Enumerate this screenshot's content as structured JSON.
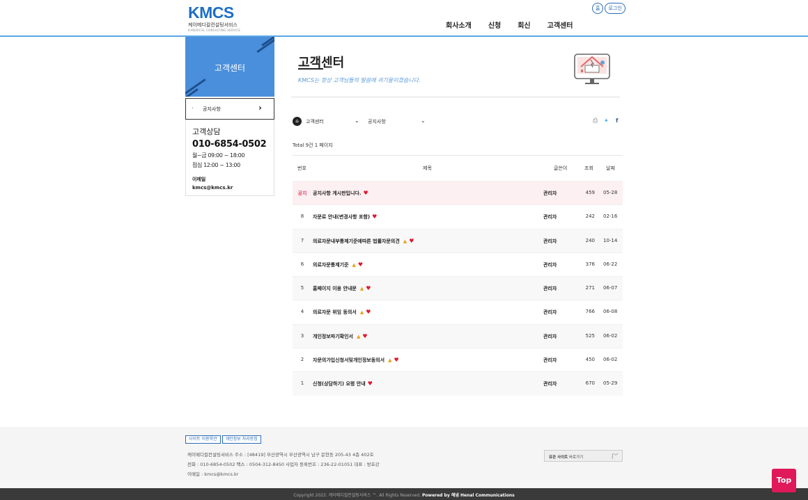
{
  "header": {
    "logo_main": "KMCS",
    "logo_sub": "케이메디컬컨설팅서비스",
    "logo_tiny": "K-MEDICAL CONSULTING SERVICE",
    "home_btn": "홈",
    "login_btn": "로그인",
    "nav": [
      "회사소개",
      "신청",
      "회신",
      "고객센터"
    ]
  },
  "sidebar": {
    "banner_title": "고객센터",
    "menu_item": "공지사항",
    "consult_title": "고객상담",
    "phone": "010-6854-0502",
    "hours_1": "월~금 09:00 ~ 18:00",
    "hours_2": "점심 12:00 ~ 13:00",
    "email_label": "이메일",
    "email": "kmcs@kmcs.kr"
  },
  "main": {
    "title": "고객센터",
    "subtitle": "KMCS는 항상 고객님들의 말씀에 귀기울이겠습니다.",
    "path_select_1": "고객센터",
    "path_select_2": "공지사항",
    "total": "Total 9건 1 페이지",
    "columns": {
      "num": "번호",
      "title": "제목",
      "author": "글쓴이",
      "views": "조회",
      "date": "날짜"
    }
  },
  "rows": [
    {
      "num": "공지",
      "title": "공지사항 게시판입니다.",
      "author": "관리자",
      "views": "459",
      "date": "05-28",
      "warn": false
    },
    {
      "num": "8",
      "title": "자문료 안내(변경사항 포함)",
      "author": "관리자",
      "views": "242",
      "date": "02-16",
      "warn": false
    },
    {
      "num": "7",
      "title": "의료자문내부통제기준에따른 법률자문의견",
      "author": "관리자",
      "views": "240",
      "date": "10-14",
      "warn": true
    },
    {
      "num": "6",
      "title": "의료자문통제기준",
      "author": "관리자",
      "views": "376",
      "date": "06-22",
      "warn": true
    },
    {
      "num": "5",
      "title": "홈페이지 이용 안내문",
      "author": "관리자",
      "views": "271",
      "date": "06-07",
      "warn": true
    },
    {
      "num": "4",
      "title": "의료자문 위임 동의서",
      "author": "관리자",
      "views": "766",
      "date": "06-08",
      "warn": true
    },
    {
      "num": "3",
      "title": "개인정보파기확인서",
      "author": "관리자",
      "views": "525",
      "date": "06-02",
      "warn": true
    },
    {
      "num": "2",
      "title": "자문의가입신청서및개인정보동의서",
      "author": "관리자",
      "views": "450",
      "date": "06-02",
      "warn": true
    },
    {
      "num": "1",
      "title": "신청(상담하기) 요령 안내",
      "author": "관리자",
      "views": "670",
      "date": "05-29",
      "warn": false
    }
  ],
  "footer": {
    "link_terms": "사이트 이용약관",
    "link_privacy": "개인정보 처리방침",
    "line_1": "케이메디컬컨설팅서비스    주소 : [48419] 부산광역시 부산광역시 남구 문현동 205-43 4층 402호",
    "line_2": "전화 : 010-6854-0502    팩스 : 0504-312-8450    사업자 등록번호 : 236-22-01051    대표 : 방효강",
    "line_3": "이메일 : kmcs@kmcs.kr",
    "related_label": "유관 사이트",
    "related_hint": "바로가기",
    "copyright": "Copyright 2023. 케이메디컬컨설팅서비스 ™. All Rights Reserved.",
    "powered": "Powered by 해냄 Henal Communications"
  },
  "top_btn": "Top",
  "colors": {
    "accent": "#4a8fdc",
    "notice_bg": "#fdf0f2",
    "top_btn": "#e0195a"
  }
}
